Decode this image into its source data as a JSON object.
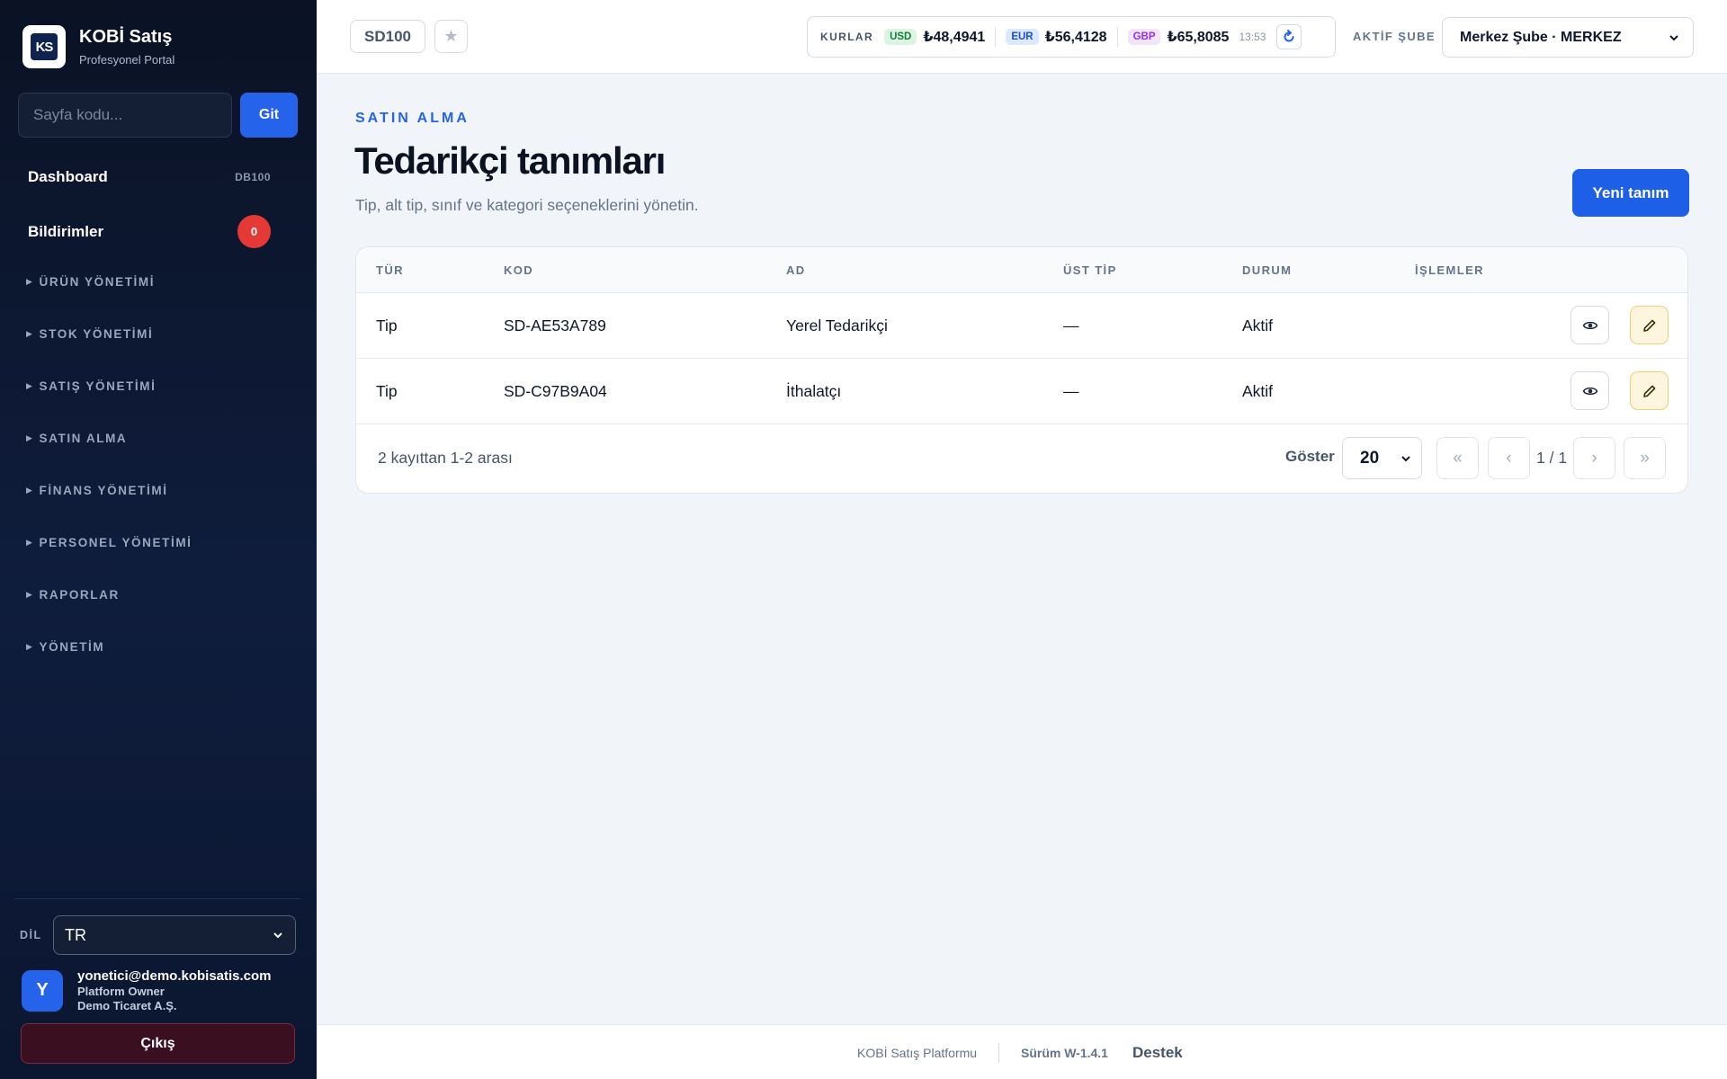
{
  "sidebar": {
    "brand_title": "KOBİ Satış",
    "brand_subtitle": "Profesyonel Portal",
    "logo_text": "KS",
    "goto_placeholder": "Sayfa kodu...",
    "goto_button": "Git",
    "dashboard": {
      "label": "Dashboard",
      "code": "DB100"
    },
    "notifications": {
      "label": "Bildirimler",
      "count": "0"
    },
    "sections": [
      "ÜRÜN YÖNETİMİ",
      "STOK YÖNETİMİ",
      "SATIŞ YÖNETİMİ",
      "SATIN ALMA",
      "FİNANS YÖNETİMİ",
      "PERSONEL YÖNETİMİ",
      "RAPORLAR",
      "YÖNETİM"
    ],
    "language_label": "DİL",
    "language_value": "TR",
    "user": {
      "initial": "Y",
      "email": "yonetici@demo.kobisatis.com",
      "role": "Platform Owner",
      "company": "Demo Ticaret A.Ş."
    },
    "logout": "Çıkış"
  },
  "topbar": {
    "page_code": "SD100",
    "rates_label": "KURLAR",
    "rates": [
      {
        "code": "USD",
        "value": "₺48,4941",
        "bg": "#dcf5e3",
        "fg": "#15803d"
      },
      {
        "code": "EUR",
        "value": "₺56,4128",
        "bg": "#dbe8fd",
        "fg": "#1d4ed8"
      },
      {
        "code": "GBP",
        "value": "₺65,8085",
        "bg": "#f3e3fb",
        "fg": "#9333ea"
      }
    ],
    "rates_time": "13:53",
    "branch_label": "AKTİF ŞUBE",
    "branch_value": "Merkez Şube · MERKEZ"
  },
  "main": {
    "eyebrow": "SATIN ALMA",
    "title": "Tedarikçi tanımları",
    "subtitle": "Tip, alt tip, sınıf ve kategori seçeneklerini yönetin.",
    "new_button": "Yeni tanım",
    "columns": [
      "TÜR",
      "KOD",
      "AD",
      "ÜST TİP",
      "DURUM",
      "İŞLEMLER"
    ],
    "rows": [
      {
        "type": "Tip",
        "code": "SD-AE53A789",
        "name": "Yerel Tedarikçi",
        "parent": "—",
        "status": "Aktif"
      },
      {
        "type": "Tip",
        "code": "SD-C97B9A04",
        "name": "İthalatçı",
        "parent": "—",
        "status": "Aktif"
      }
    ],
    "record_count": "2 kayıttan 1-2 arası",
    "show_label": "Göster",
    "page_size": "20",
    "page_info": "1 / 1",
    "pager": {
      "first": "«",
      "prev": "‹",
      "next": "›",
      "last": "»"
    }
  },
  "footer": {
    "brand": "KOBİ Satış Platformu",
    "version": "Sürüm W-1.4.1",
    "support": "Destek"
  },
  "colors": {
    "accent": "#2563eb",
    "sidebar_bg": "#0f1d3d",
    "danger": "#e53935",
    "edit_bg": "#fdf5dd"
  }
}
